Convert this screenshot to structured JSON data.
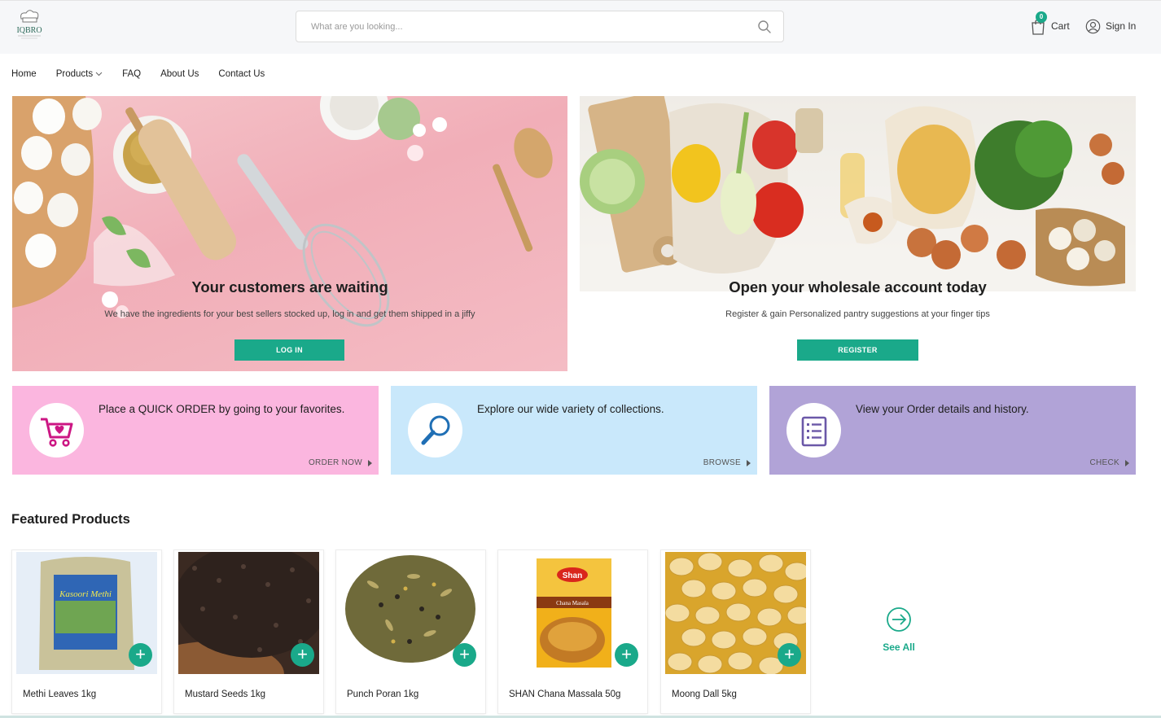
{
  "header": {
    "brand": "IQBRO",
    "search_placeholder": "What are you looking...",
    "cart_count": "0",
    "cart_label": "Cart",
    "signin_label": "Sign In"
  },
  "nav": [
    "Home",
    "Products",
    "FAQ",
    "About Us",
    "Contact Us"
  ],
  "hero": [
    {
      "title": "Your customers are waiting",
      "subtitle": "We have the ingredients for your best sellers stocked up, log in and get them shipped in a jiffy",
      "button": "LOG IN"
    },
    {
      "title": "Open your wholesale account today",
      "subtitle": "Register & gain Personalized pantry suggestions at your finger tips",
      "button": "REGISTER"
    }
  ],
  "cards": [
    {
      "text": "Place a QUICK ORDER by going to your favorites.",
      "link": "ORDER NOW",
      "icon": "cart-heart-icon",
      "color": "#fbb6df"
    },
    {
      "text": "Explore our wide variety of collections.",
      "link": "BROWSE",
      "icon": "magnifier-icon",
      "color": "#c9e8fb"
    },
    {
      "text": "View your Order details and history.",
      "link": "CHECK",
      "icon": "order-list-icon",
      "color": "#b1a3d7"
    }
  ],
  "featured_title": "Featured Products",
  "products": [
    {
      "name": "Methi Leaves 1kg",
      "package_text": "Kasoori Methi"
    },
    {
      "name": "Mustard Seeds 1kg"
    },
    {
      "name": "Punch Poran 1kg"
    },
    {
      "name": "SHAN Chana Massala 50g",
      "package_brand": "Shan",
      "package_text": "Chana Masala"
    },
    {
      "name": "Moong Dall 5kg"
    }
  ],
  "see_all": "See All",
  "colors": {
    "accent": "#1aa98a"
  }
}
